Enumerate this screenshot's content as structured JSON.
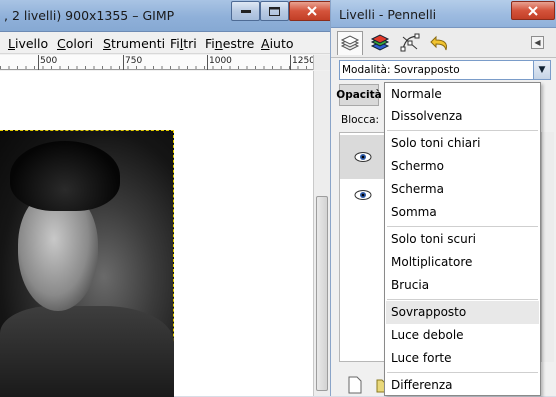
{
  "main_window": {
    "title": ", 2 livelli) 900x1355 – GIMP",
    "caption_minimize": "▬",
    "caption_maximize": "▭",
    "caption_close": "✕"
  },
  "menubar": [
    {
      "u": "L",
      "rest": "ivello"
    },
    {
      "u": "C",
      "rest": "olori"
    },
    {
      "u": "S",
      "rest": "trumenti"
    },
    {
      "u": "",
      "pre": "Fi",
      "u2": "l",
      "rest": "tri"
    },
    {
      "u": "",
      "pre": "Fi",
      "u2": "n",
      "rest": "estre"
    },
    {
      "u": "A",
      "rest": "iuto"
    }
  ],
  "ruler": {
    "labels": [
      "500",
      "750",
      "1000",
      "1250"
    ]
  },
  "dock": {
    "title": "Livelli - Pennelli",
    "close": "✕",
    "tab_menu": "◀",
    "mode_label": "Modalità:",
    "mode_value": "Sovrapposto",
    "mode_arrow": "▼",
    "opacity_label": "Opacità",
    "lock_label": "Blocca:"
  },
  "dropdown": {
    "groups": [
      [
        "Normale",
        "Dissolvenza"
      ],
      [
        "Solo toni chiari",
        "Schermo",
        "Scherma",
        "Somma"
      ],
      [
        "Solo toni scuri",
        "Moltiplicatore",
        "Brucia"
      ],
      [
        "Sovrapposto",
        "Luce debole",
        "Luce forte"
      ],
      [
        "Differenza"
      ]
    ],
    "selected": "Sovrapposto"
  },
  "colors": {
    "titlebar": "#8fb0d9",
    "selection_marquee": "#e9d000",
    "dropdown_selected_bg": "#e8e8e8"
  },
  "icons": {
    "tabs": [
      "layers-icon",
      "channels-icon",
      "paths-icon",
      "undo-history-icon"
    ],
    "layer_visibility": "eye-icon"
  }
}
